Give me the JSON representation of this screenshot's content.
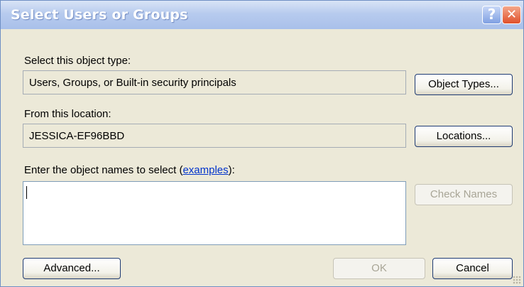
{
  "window": {
    "title": "Select Users or Groups",
    "help_label": "?",
    "close_label": "✕"
  },
  "object_type": {
    "label": "Select this object type:",
    "value": "Users, Groups, or Built-in security principals",
    "button_label": "Object Types..."
  },
  "location": {
    "label": "From this location:",
    "value": "JESSICA-EF96BBD",
    "button_label": "Locations..."
  },
  "names": {
    "label_prefix": "Enter the object names to select (",
    "link_text": "examples",
    "label_suffix": "):",
    "value": "",
    "check_names_label": "Check Names"
  },
  "footer": {
    "advanced_label": "Advanced...",
    "ok_label": "OK",
    "cancel_label": "Cancel"
  },
  "colors": {
    "dialog_bg": "#ece9d8",
    "title_text": "#ffffff",
    "link": "#0033cc"
  }
}
